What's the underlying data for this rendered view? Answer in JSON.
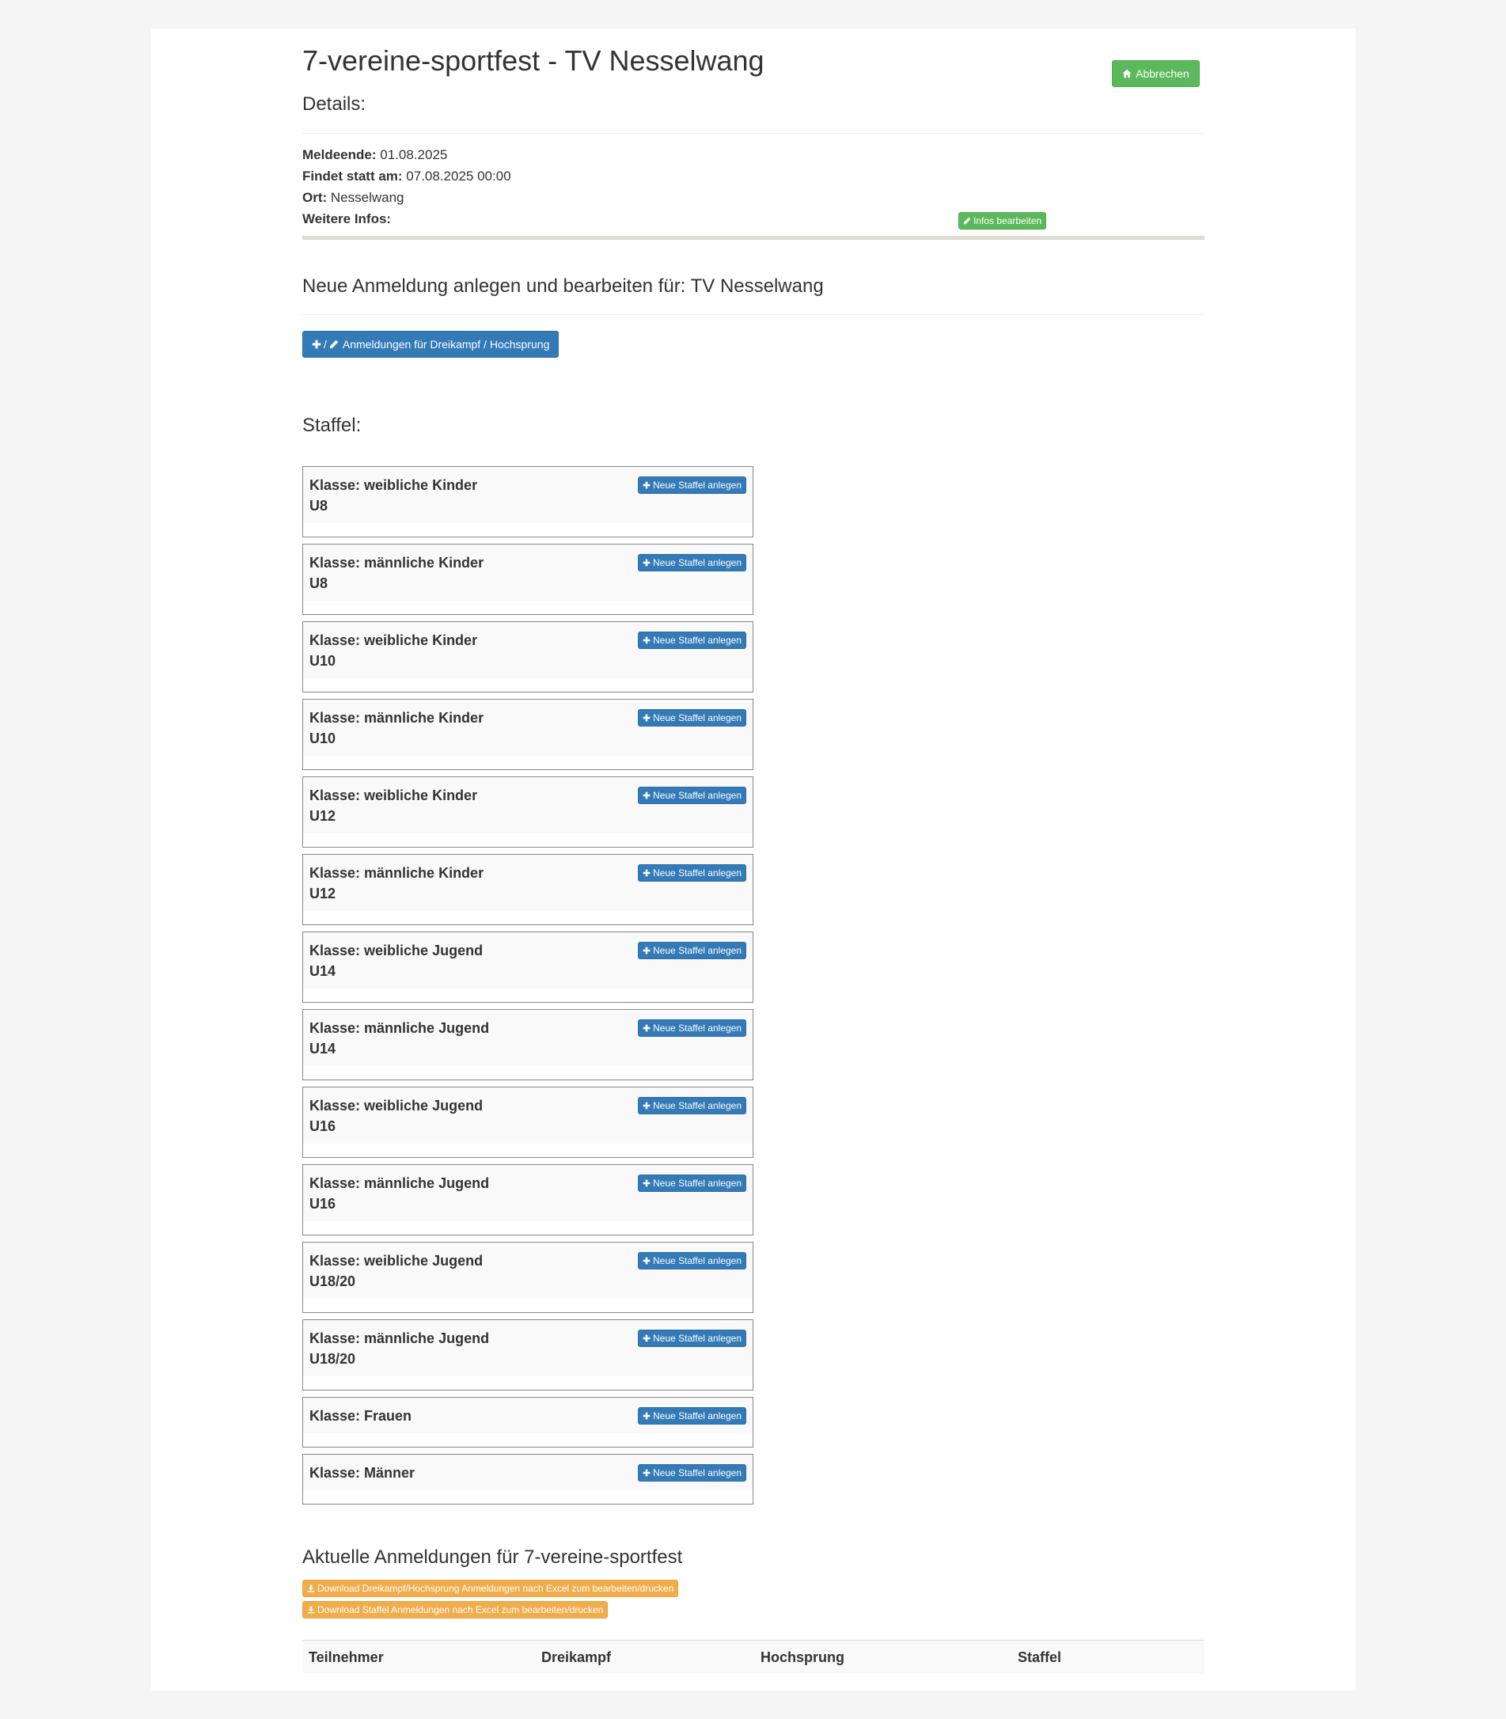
{
  "header": {
    "title": "7-vereine-sportfest - TV Nesselwang",
    "cancel_label": "Abbrechen"
  },
  "details": {
    "heading": "Details:",
    "meldeende_label": "Meldeende:",
    "meldeende_value": "01.08.2025",
    "findet_label": "Findet statt am:",
    "findet_value": "07.08.2025 00:00",
    "ort_label": "Ort:",
    "ort_value": "Nesselwang",
    "weitere_label": "Weitere Infos:",
    "weitere_value": "",
    "edit_label": "Infos bearbeiten"
  },
  "anmeldung": {
    "heading": "Neue Anmeldung anlegen und bearbeiten für: TV Nesselwang",
    "button_sep": "/",
    "button_label": "Anmeldungen für Dreikampf / Hochsprung"
  },
  "staffel": {
    "heading": "Staffel:",
    "button_label": "Neue Staffel anlegen",
    "klassen": [
      {
        "line1": "Klasse: weibliche Kinder",
        "line2": "U8"
      },
      {
        "line1": "Klasse: männliche Kinder",
        "line2": "U8"
      },
      {
        "line1": "Klasse: weibliche Kinder",
        "line2": "U10"
      },
      {
        "line1": "Klasse: männliche Kinder",
        "line2": "U10"
      },
      {
        "line1": "Klasse: weibliche Kinder",
        "line2": "U12"
      },
      {
        "line1": "Klasse: männliche Kinder",
        "line2": "U12"
      },
      {
        "line1": "Klasse: weibliche Jugend",
        "line2": "U14"
      },
      {
        "line1": "Klasse: männliche Jugend",
        "line2": "U14"
      },
      {
        "line1": "Klasse: weibliche Jugend",
        "line2": "U16"
      },
      {
        "line1": "Klasse: männliche Jugend",
        "line2": "U16"
      },
      {
        "line1": "Klasse: weibliche Jugend",
        "line2": "U18/20"
      },
      {
        "line1": "Klasse: männliche Jugend",
        "line2": "U18/20"
      },
      {
        "line1": "Klasse: Frauen",
        "line2": ""
      },
      {
        "line1": "Klasse: Männer",
        "line2": ""
      }
    ]
  },
  "aktuell": {
    "heading": "Aktuelle Anmeldungen für 7-vereine-sportfest",
    "download_dreikampf": "Download Dreikampf/Hochsprung Anmeldungen nach Excel zum bearbeiten/drucken",
    "download_staffel": "Download Staffel Anmeldungen nach Excel zum bearbeiten/drucken",
    "columns": [
      "Teilnehmer",
      "Dreikampf",
      "Hochsprung",
      "Staffel"
    ]
  },
  "colors": {
    "success": "#5cb85c",
    "primary": "#337ab7",
    "warning": "#f0ad4e"
  },
  "icons": {
    "cancel": "home-icon",
    "edit": "pencil-icon",
    "add": "plus-icon",
    "download": "download-icon"
  }
}
